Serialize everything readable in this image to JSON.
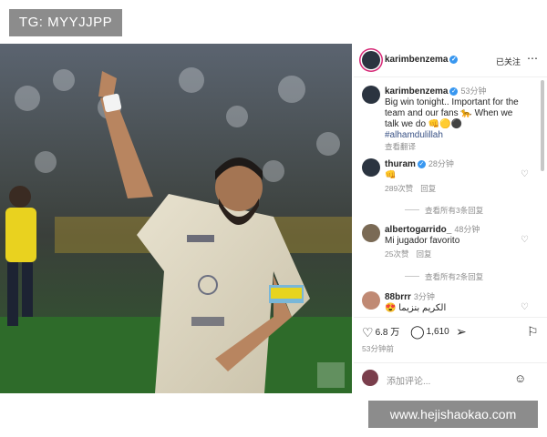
{
  "tags": {
    "tg": "TG: MYYJJPP"
  },
  "post": {
    "author": "karimbenzema",
    "follow_label": "已关注",
    "more_icon": "ellipsis-icon"
  },
  "comments": [
    {
      "user": "karimbenzema",
      "verified": true,
      "time": "53分钟",
      "text": "Big win tonight.. Important for the team and our fans 🐆 When we talk we do 👊🟡⚫",
      "hashtag": "#alhamdulillah",
      "translate": "查看翻译"
    },
    {
      "user": "thuram",
      "verified": true,
      "time": "28分钟",
      "text": "👊",
      "likes": "289次赞",
      "reply": "回复",
      "view_replies": "查看所有3条回复"
    },
    {
      "user": "albertogarrido_",
      "verified": false,
      "time": "48分钟",
      "text": "Mi jugador favorito",
      "likes": "25次赞",
      "reply": "回复",
      "view_replies": "查看所有2条回复"
    },
    {
      "user": "88brrr",
      "verified": false,
      "time": "3分钟",
      "text": "😍 الكريم بنزيما"
    }
  ],
  "actions": {
    "like_count": "6.8 万",
    "comment_count": "1,610",
    "posted_ago": "53分钟前"
  },
  "add_comment": {
    "placeholder": "添加评论..."
  },
  "watermark": "www.hejishaokao.com",
  "colors": {
    "verified": "#3897f0",
    "hashtag": "#385185",
    "muted": "#8e8e8e"
  }
}
